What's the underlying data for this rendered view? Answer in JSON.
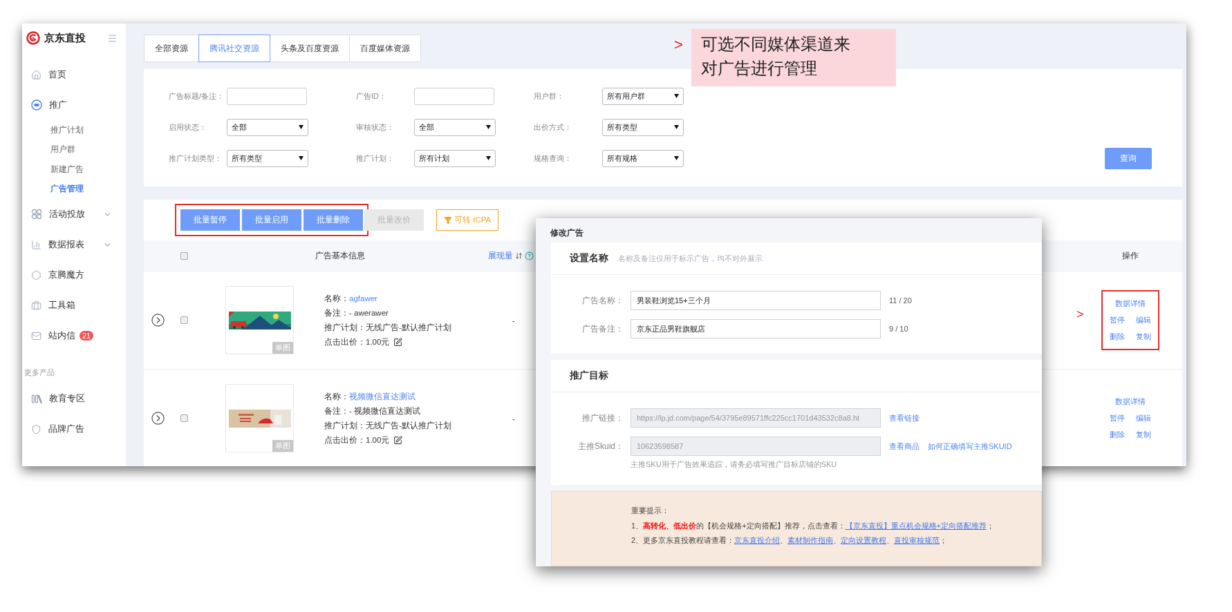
{
  "sidebar": {
    "brand": "京东直投",
    "items": [
      {
        "label": "首页",
        "selected": false
      },
      {
        "label": "推广",
        "selected": false,
        "expanded": true,
        "children": [
          {
            "label": "推广计划",
            "selected": false
          },
          {
            "label": "用户群",
            "selected": false
          },
          {
            "label": "新建广告",
            "selected": false
          },
          {
            "label": "广告管理",
            "selected": true
          }
        ]
      },
      {
        "label": "活动投放",
        "selected": false,
        "expanded": false
      },
      {
        "label": "数据报表",
        "selected": false,
        "expanded": false
      },
      {
        "label": "京腾魔方",
        "selected": false
      },
      {
        "label": "工具箱",
        "selected": false
      },
      {
        "label": "站内信",
        "selected": false,
        "badge": "21"
      }
    ],
    "section_label": "更多产品",
    "more_items": [
      {
        "label": "教育专区",
        "selected": false
      },
      {
        "label": "品牌广告",
        "selected": false
      }
    ]
  },
  "tabs": [
    {
      "label": "全部资源",
      "selected": false
    },
    {
      "label": "腾讯社交资源",
      "selected": true
    },
    {
      "label": "头条及百度资源",
      "selected": false
    },
    {
      "label": "百度媒体资源",
      "selected": false
    }
  ],
  "annotation": {
    "marker": ">",
    "lines": [
      "可选不同媒体渠道来",
      "对广告进行管理"
    ]
  },
  "filters": [
    {
      "label": "广告标题/备注：",
      "kind": "input"
    },
    {
      "label": "广告ID：",
      "kind": "input"
    },
    {
      "label": "用户群：",
      "kind": "select",
      "value": "所有用户群"
    },
    {
      "label": "启用状态：",
      "kind": "select",
      "value": "全部"
    },
    {
      "label": "审核状态：",
      "kind": "select",
      "value": "全部"
    },
    {
      "label": "出价方式：",
      "kind": "select",
      "value": "所有类型"
    },
    {
      "label": "推广计划类型：",
      "kind": "select",
      "value": "所有类型"
    },
    {
      "label": "推广计划：",
      "kind": "select",
      "value": "所有计划"
    },
    {
      "label": "规格查询：",
      "kind": "select",
      "value": "所有规格"
    }
  ],
  "query_button": "查询",
  "batch_highlighted": true,
  "batch_actions": [
    {
      "label": "批量暂停",
      "disabled": false
    },
    {
      "label": "批量启用",
      "disabled": false
    },
    {
      "label": "批量删除",
      "disabled": false
    },
    {
      "label": "批量改价",
      "disabled": true
    }
  ],
  "tcpa_button": "可转 tCPA",
  "table": {
    "header_checked": false,
    "info_header": "广告基本信息",
    "impressions_header": "展现量",
    "actions_header": "操作",
    "rows": [
      {
        "checked": false,
        "tag": "单图",
        "fields": [
          {
            "label": "名称：",
            "value": "agfawer",
            "kind": "link"
          },
          {
            "label": "备注：",
            "value": "- awerawer",
            "kind": "text"
          },
          {
            "label": "推广计划：",
            "value": "无线广告-默认推广计划",
            "kind": "text"
          },
          {
            "label": "点击出价：",
            "value": "1.00元",
            "kind": "bid"
          }
        ],
        "impressions": "-",
        "actions": [
          "数据详情",
          "暂停",
          "编辑",
          "删除",
          "复制"
        ],
        "highlighted": true,
        "marker": ">"
      },
      {
        "checked": false,
        "tag": "单图",
        "fields": [
          {
            "label": "名称：",
            "value": "视频微信直达测试",
            "kind": "link"
          },
          {
            "label": "备注：",
            "value": "- 视频微信直达测试",
            "kind": "text"
          },
          {
            "label": "推广计划：",
            "value": "无线广告-默认推广计划",
            "kind": "text"
          },
          {
            "label": "点击出价：",
            "value": "1.00元",
            "kind": "bid"
          }
        ],
        "impressions": "-",
        "actions": [
          "数据详情",
          "暂停",
          "编辑",
          "删除",
          "复制"
        ],
        "highlighted": false
      }
    ]
  },
  "modal": {
    "title": "修改广告",
    "sections": [
      {
        "title": "设置名称",
        "hint": "名称及备注仅用于标示广告，均不对外展示",
        "fields": [
          {
            "label": "广告名称：",
            "value": "男装鞋浏览15+三个月",
            "counter": "11 / 20",
            "disabled": false
          },
          {
            "label": "广告备注：",
            "value": "京东正品男鞋旗舰店",
            "counter": "9 / 10",
            "disabled": false
          }
        ]
      },
      {
        "title": "推广目标",
        "fields": [
          {
            "label": "推广链接：",
            "value": "https://lp.jd.com/page/54/3795e89571ffc225cc1701d43532c8a8.ht",
            "disabled": true,
            "links": [
              "查看链接"
            ]
          },
          {
            "label": "主推Skuid：",
            "value": "10623598587",
            "disabled": true,
            "links": [
              "查看商品",
              "如何正确填写主推SKUID"
            ],
            "help": "主推SKU用于广告效果追踪，请务必填写推广目标店铺的SKU"
          }
        ]
      }
    ],
    "notice": {
      "title": "重要提示：",
      "lines": [
        [
          {
            "kind": "text",
            "text": "1、**高转化、低出价**的【机会规格+定向搭配】推荐，点击查看："
          },
          {
            "kind": "link",
            "text": "【京东直投】重点机会规格+定向搭配推荐"
          },
          {
            "kind": "text",
            "text": "；"
          }
        ],
        [
          {
            "kind": "text",
            "text": "2、更多京东直投教程请查看："
          },
          {
            "kind": "link",
            "text": "京东直投介绍"
          },
          {
            "kind": "text",
            "text": "、"
          },
          {
            "kind": "link",
            "text": "素材制作指南"
          },
          {
            "kind": "text",
            "text": "、"
          },
          {
            "kind": "link",
            "text": "定向设置教程"
          },
          {
            "kind": "text",
            "text": "、"
          },
          {
            "kind": "link",
            "text": "直投审核规范"
          },
          {
            "kind": "text",
            "text": "；"
          }
        ]
      ]
    }
  }
}
